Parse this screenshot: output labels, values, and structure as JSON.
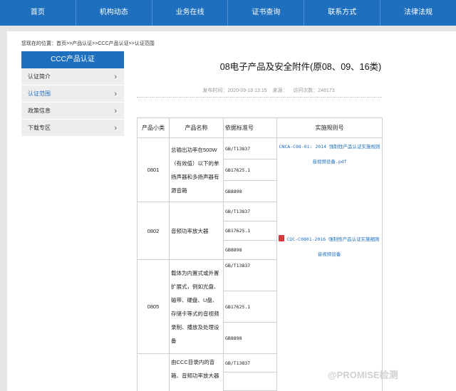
{
  "nav": {
    "items": [
      "首页",
      "机构动态",
      "业务在线",
      "证书查询",
      "联系方式",
      "法律法规"
    ]
  },
  "breadcrumb": "您现在的位置：首页>>产品认证>>CCC产品认证>>认证范围",
  "sidebar": {
    "title": "CCC产品认证",
    "items": [
      {
        "label": "认证简介"
      },
      {
        "label": "认证范围"
      },
      {
        "label": "政策信息"
      },
      {
        "label": "下载专区"
      }
    ]
  },
  "article": {
    "title": "08电子产品及安全附件(原08、09、16类)",
    "meta": "发布时间：2020-09-18 13:15    来源：    访问次数：248173"
  },
  "table": {
    "headers": [
      "产品小类",
      "产品名称",
      "依据标准号",
      "实施规则号"
    ],
    "rows": [
      {
        "code": "0801",
        "name": "总输出功率在500W（有效值）以下的单扬声器和多扬声器有源音箱",
        "standards": [
          "GB/T13837",
          "GB17625.1",
          "GB8898"
        ]
      },
      {
        "code": "0802",
        "name": "音频功率放大器",
        "standards": [
          "GB/T13837",
          "GB17625.1",
          "GB8898"
        ]
      },
      {
        "code": "0805",
        "name": "载体为内置式或外置扩展式，例如光盘、磁带、硬盘、U盘、存储卡等式的音视频录制、播放及处理设备",
        "standards": [
          "GB/T13837",
          "GB17625.1",
          "GB8898"
        ]
      },
      {
        "code": "",
        "name": "由CCC目录内的音箱、音频功率放大器",
        "standards": [
          "GB/T13837"
        ]
      }
    ],
    "rule1": "CNCA-C08-01: 2014 强制性产品认证实施规则音视频设备.pdf",
    "rule2": "CQC-C0801-2016 强制性产品认证实施细则 音视频设备"
  },
  "watermark": "@PROMISE检测",
  "colors": {
    "brand": "#1e6fbd",
    "link": "#1e6fbd"
  }
}
